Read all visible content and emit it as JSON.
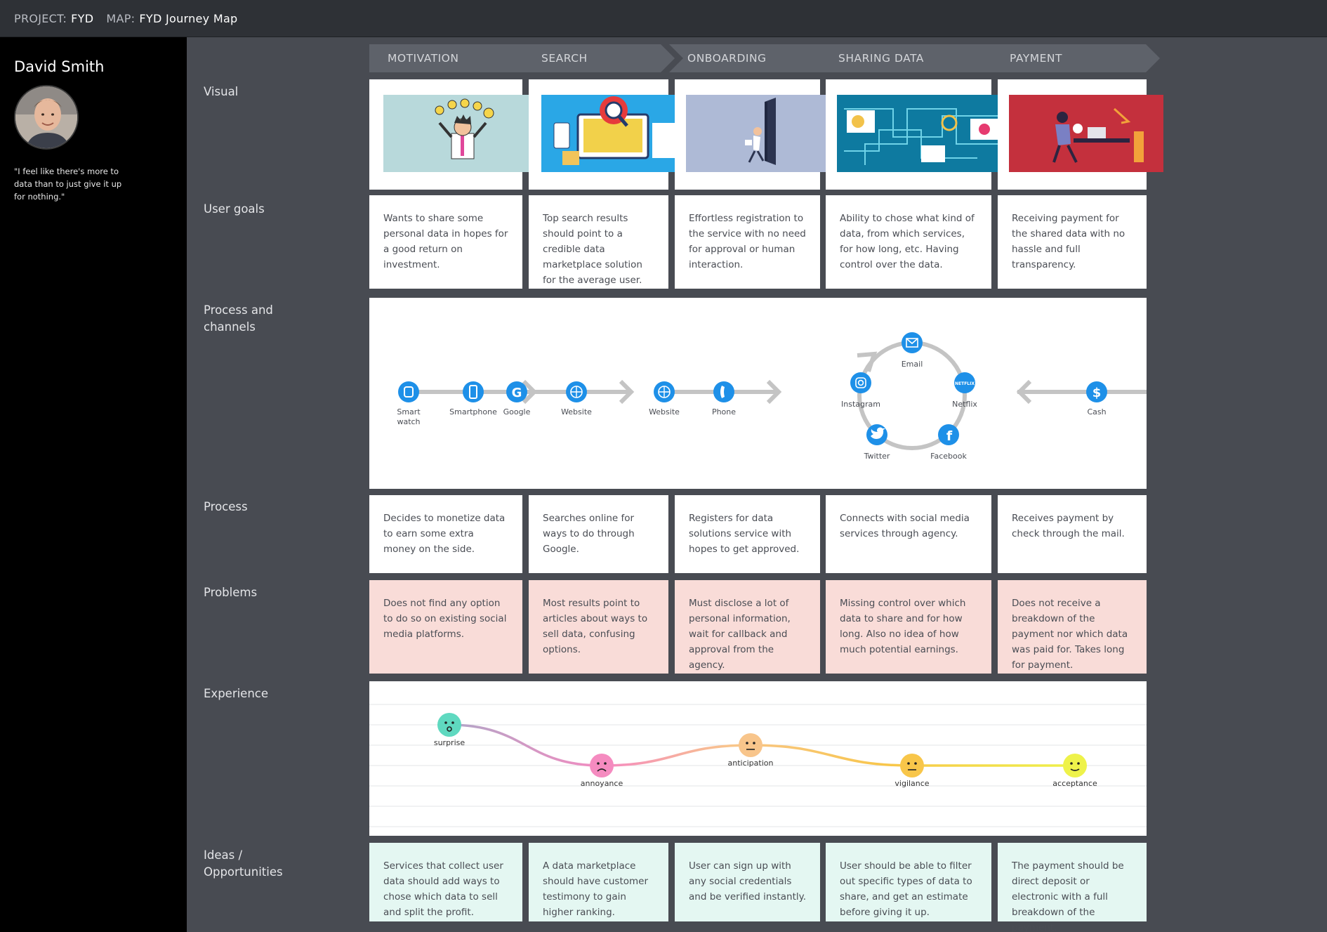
{
  "header": {
    "project_key": "PROJECT:",
    "project_value": "FYD",
    "map_key": "MAP:",
    "map_value": "FYD Journey Map"
  },
  "persona": {
    "name": "David Smith",
    "quote": "\"I feel like there's more to data than to just give it up for nothing.\""
  },
  "rows": {
    "visual": "Visual",
    "user_goals": "User goals",
    "process_channels": "Process and channels",
    "process": "Process",
    "problems": "Problems",
    "experience": "Experience",
    "ideas": "Ideas / Opportunities"
  },
  "stages": [
    "MOTIVATION",
    "SEARCH",
    "ONBOARDING",
    "SHARING DATA",
    "PAYMENT"
  ],
  "user_goals": [
    "Wants to share some personal data in hopes for a good return on investment.",
    "Top search results should point to a credible data marketplace solution for the average user.",
    "Effortless registration to the service with no need for approval or human interaction.",
    "Ability to chose what kind of data, from which services, for how long, etc. Having control over the data.",
    "Receiving payment for the shared data with no hassle and full transparency."
  ],
  "channels": {
    "motivation": [
      "Smart watch",
      "Smartphone"
    ],
    "search": [
      "Google",
      "Website"
    ],
    "onboarding": [
      "Website",
      "Phone"
    ],
    "sharing": [
      "Email",
      "Netflix",
      "Facebook",
      "Twitter",
      "Instagram"
    ],
    "payment": [
      "Cash"
    ]
  },
  "process": [
    "Decides to monetize data to earn some extra money on the side.",
    "Searches online for ways to do through Google.",
    "Registers for data solutions service with hopes to get approved.",
    "Connects with social media services through agency.",
    "Receives payment by check through the mail."
  ],
  "problems": [
    "Does not find any option to do so on existing social media platforms.",
    "Most results point to articles about ways to sell data, confusing options.",
    "Must disclose a lot of personal information, wait for callback and approval from the agency.",
    "Missing control over which data to share and for how long. Also no idea of how much potential earnings.",
    "Does not receive a breakdown of the payment nor which data was paid for. Takes long for payment."
  ],
  "experience": [
    {
      "emotion": "surprise",
      "level": 5,
      "color": "#5fd9c0"
    },
    {
      "emotion": "annoyance",
      "level": 3,
      "color": "#f58bc0"
    },
    {
      "emotion": "anticipation",
      "level": 4,
      "color": "#f8c58b"
    },
    {
      "emotion": "vigilance",
      "level": 3,
      "color": "#f8c64a"
    },
    {
      "emotion": "acceptance",
      "level": 3,
      "color": "#eef24a"
    }
  ],
  "ideas": [
    "Services that collect user data should add ways to chose which data to sell and split the profit.",
    "A data marketplace should have customer testimony to gain higher ranking.",
    "User can sign up with any social credentials and be verified instantly.",
    "User should be able to filter out specific types of data to share, and get an estimate before giving it up.",
    "The payment should be direct deposit or electronic with a full breakdown of the payment."
  ],
  "colors": {
    "background": "#484b52",
    "topbar": "#2e3136",
    "stage": "#5e626a",
    "problem_card": "#f9dcd8",
    "idea_card": "#e4f7f2",
    "channel_icon": "#1e90e8"
  }
}
